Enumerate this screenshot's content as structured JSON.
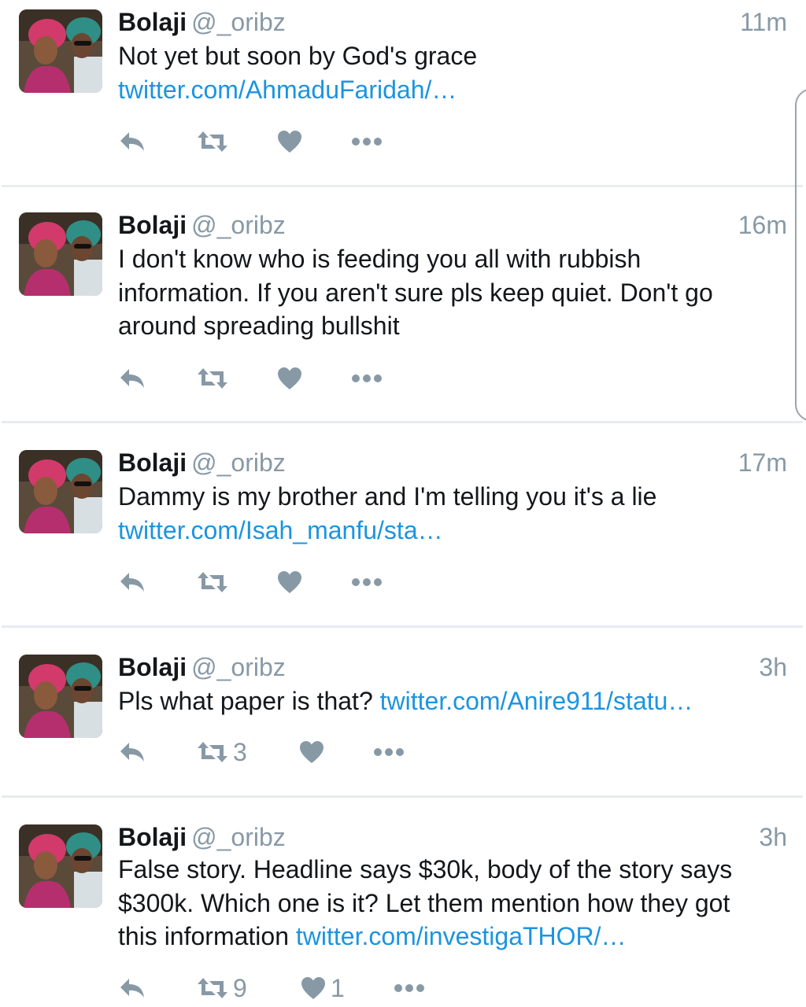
{
  "colors": {
    "link": "#1c94e0",
    "muted": "#8899a6",
    "divider": "#e6ecf0"
  },
  "tweets": [
    {
      "name": "Bolaji",
      "handle": "@_oribz",
      "time": "11m",
      "text_lines": [
        {
          "plain": "Not yet but soon by God's grace",
          "link": ""
        },
        {
          "plain": "",
          "link": "twitter.com/AhmaduFaridah/…"
        }
      ],
      "retweets": "",
      "likes": ""
    },
    {
      "name": "Bolaji",
      "handle": "@_oribz",
      "time": "16m",
      "text_lines": [
        {
          "plain": "I don't know who is feeding you all with rubbish",
          "link": ""
        },
        {
          "plain": "information. If you aren't sure pls keep quiet. Don't go",
          "link": ""
        },
        {
          "plain": "around spreading bullshit",
          "link": ""
        }
      ],
      "retweets": "",
      "likes": ""
    },
    {
      "name": "Bolaji",
      "handle": "@_oribz",
      "time": "17m",
      "text_lines": [
        {
          "plain": "Dammy is my brother and I'm telling you it's a lie",
          "link": ""
        },
        {
          "plain": "",
          "link": "twitter.com/Isah_manfu/sta…"
        }
      ],
      "retweets": "",
      "likes": ""
    },
    {
      "name": "Bolaji",
      "handle": "@_oribz",
      "time": "3h",
      "text_lines": [
        {
          "plain": "Pls what paper is that? ",
          "link": "twitter.com/Anire911/statu…"
        }
      ],
      "retweets": "3",
      "likes": ""
    },
    {
      "name": "Bolaji",
      "handle": "@_oribz",
      "time": "3h",
      "text_lines": [
        {
          "plain": "False story. Headline says $30k, body of the story says",
          "link": ""
        },
        {
          "plain": "$300k. Which one is it? Let them mention how they got",
          "link": ""
        },
        {
          "plain": "this information ",
          "link": "twitter.com/investigaTHOR/…"
        }
      ],
      "retweets": "9",
      "likes": "1"
    }
  ],
  "icons": {
    "reply": "reply-icon",
    "retweet": "retweet-icon",
    "like": "heart-icon",
    "more": "more-icon"
  }
}
